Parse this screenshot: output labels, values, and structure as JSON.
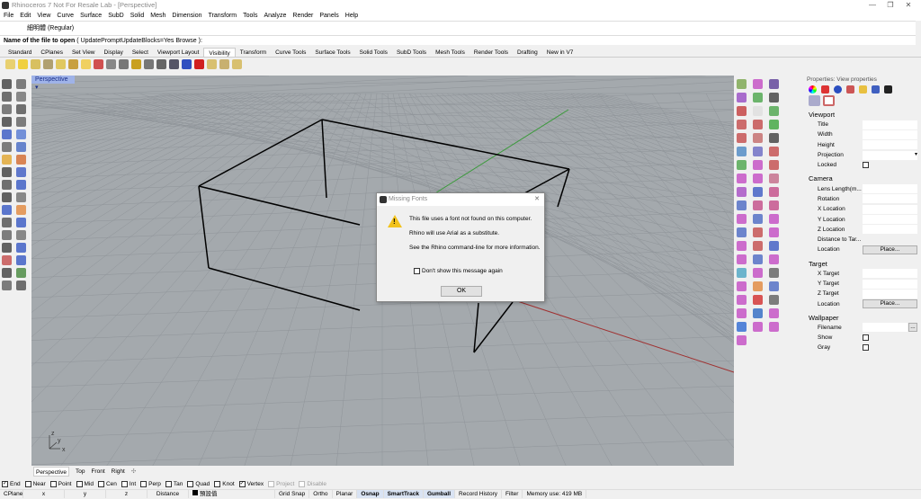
{
  "window": {
    "title": "Rhinoceros 7 Not For Resale Lab - [Perspective]",
    "min": "—",
    "max": "❐",
    "close": "✕"
  },
  "menu": [
    "File",
    "Edit",
    "View",
    "Curve",
    "Surface",
    "SubD",
    "Solid",
    "Mesh",
    "Dimension",
    "Transform",
    "Tools",
    "Analyze",
    "Render",
    "Panels",
    "Help"
  ],
  "command": {
    "history": "細明體 (Regular)",
    "prompt": "Name of the file to open",
    "options": "( UpdatePromptUpdateBlocks=Yes  Browse ):"
  },
  "tabs": [
    "Standard",
    "CPlanes",
    "Set View",
    "Display",
    "Select",
    "Viewport Layout",
    "Visibility",
    "Transform",
    "Curve Tools",
    "Surface Tools",
    "Solid Tools",
    "SubD Tools",
    "Mesh Tools",
    "Render Tools",
    "Drafting",
    "New in V7"
  ],
  "active_tab": "Visibility",
  "viewport": {
    "name": "Perspective",
    "axis_labels": {
      "x": "x",
      "y": "y",
      "z": "z"
    }
  },
  "viewport_tabs": [
    "Perspective",
    "Top",
    "Front",
    "Right"
  ],
  "dialog": {
    "title": "Missing Fonts",
    "line1": "This file uses a font not found on this computer.",
    "line2": "Rhino will use Arial as a substitute.",
    "line3": "See the Rhino command-line for more information.",
    "checkbox": "Don't show this message again",
    "ok": "OK"
  },
  "properties": {
    "title": "Properties: View properties",
    "viewport_section": "Viewport",
    "title_lbl": "Title",
    "width": "Width",
    "height": "Height",
    "projection": "Projection",
    "locked": "Locked",
    "camera_section": "Camera",
    "lens": "Lens Length(m...",
    "rotation": "Rotation",
    "xloc": "X Location",
    "yloc": "Y Location",
    "zloc": "Z Location",
    "dist": "Distance to Tar...",
    "location": "Location",
    "place": "Place...",
    "target_section": "Target",
    "xt": "X Target",
    "yt": "Y Target",
    "zt": "Z Target",
    "wallpaper_section": "Wallpaper",
    "filename": "Filename",
    "browse": "...",
    "show": "Show",
    "gray": "Gray"
  },
  "osnap": [
    {
      "label": "End",
      "checked": true
    },
    {
      "label": "Near",
      "checked": false
    },
    {
      "label": "Point",
      "checked": false
    },
    {
      "label": "Mid",
      "checked": false
    },
    {
      "label": "Cen",
      "checked": false
    },
    {
      "label": "Int",
      "checked": false
    },
    {
      "label": "Perp",
      "checked": false
    },
    {
      "label": "Tan",
      "checked": false
    },
    {
      "label": "Quad",
      "checked": false
    },
    {
      "label": "Knot",
      "checked": false
    },
    {
      "label": "Vertex",
      "checked": true
    },
    {
      "label": "Project",
      "checked": false,
      "disabled": true
    },
    {
      "label": "Disable",
      "checked": false,
      "disabled": true
    }
  ],
  "status": {
    "cplane": "CPlane",
    "x": "x",
    "y": "y",
    "z": "z",
    "distance": "Distance",
    "layer": "預設值",
    "items": [
      "Grid Snap",
      "Ortho",
      "Planar",
      "Osnap",
      "SmartTrack",
      "Gumball",
      "Record History",
      "Filter"
    ],
    "bold": [
      "Osnap",
      "SmartTrack",
      "Gumball"
    ],
    "memory": "Memory use: 419 MB"
  },
  "colors": {
    "viewport": "#a4a9ad",
    "grid": "#8f9499",
    "x_axis": "#a03030",
    "y_axis": "#3a9a3a",
    "vp_tab": "#9fb3e8"
  }
}
